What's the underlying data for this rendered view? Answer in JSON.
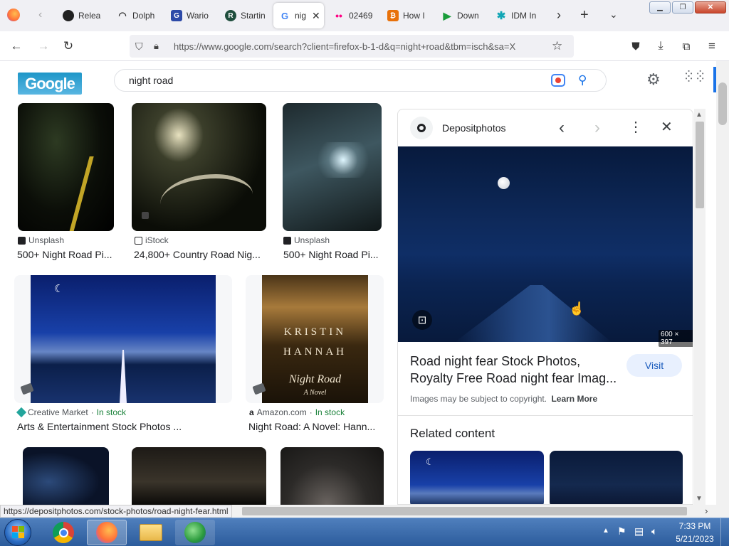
{
  "tabs": [
    {
      "label": "Relea",
      "icon": "github-icon"
    },
    {
      "label": "Dolph",
      "icon": "dolphin-icon"
    },
    {
      "label": "Wario",
      "icon": "wario-icon"
    },
    {
      "label": "Startin",
      "icon": "r-icon"
    },
    {
      "label": "nig",
      "icon": "google-icon"
    },
    {
      "label": "02469",
      "icon": "flickr-icon"
    },
    {
      "label": "How I",
      "icon": "howto-icon"
    },
    {
      "label": "Down",
      "icon": "play-icon"
    },
    {
      "label": "IDM In",
      "icon": "idm-icon"
    }
  ],
  "url": "https://www.google.com/search?client=firefox-b-1-d&q=night+road&tbm=isch&sa=X",
  "search": {
    "query": "night road",
    "logo": "Google"
  },
  "results": [
    {
      "source": "Unsplash",
      "title": "500+ Night Road Pi...",
      "stock": ""
    },
    {
      "source": "iStock",
      "title": "24,800+ Country Road Nig...",
      "stock": ""
    },
    {
      "source": "Unsplash",
      "title": "500+ Night Road Pi...",
      "stock": ""
    },
    {
      "source": "Creative Market",
      "title": "Arts & Entertainment Stock Photos ...",
      "stock": "In stock"
    },
    {
      "source": "Amazon.com",
      "title": "Night Road: A Novel: Hann...",
      "stock": "In stock"
    }
  ],
  "book": {
    "author1": "KRISTIN",
    "author2": "HANNAH",
    "title": "Night Road",
    "sub": "A Novel"
  },
  "panel": {
    "source": "Depositphotos",
    "dimensions": "600 × 397",
    "title_line1": "Road night fear Stock Photos,",
    "title_line2": "Royalty Free Road night fear Imag...",
    "visit": "Visit",
    "copyright": "Images may be subject to copyright.",
    "learn_more": "Learn More",
    "related": "Related content"
  },
  "status_url": "https://depositphotos.com/stock-photos/road-night-fear.html",
  "clock": {
    "time": "7:33 PM",
    "date": "5/21/2023"
  }
}
